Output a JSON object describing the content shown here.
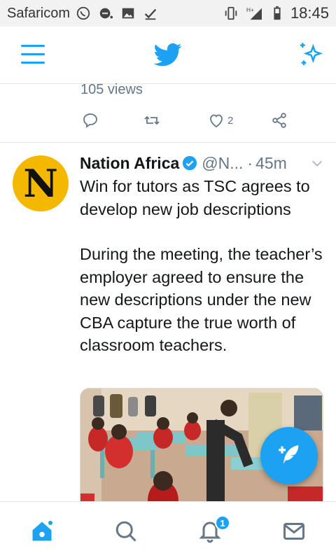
{
  "status_bar": {
    "carrier": "Safaricom",
    "network": "H+",
    "time": "18:45",
    "icons": [
      "whatsapp-icon",
      "chat-icon",
      "image-icon",
      "check-icon",
      "vibrate-icon",
      "signal-icon",
      "battery-icon"
    ]
  },
  "header": {
    "menu_icon": "hamburger-icon",
    "logo": "twitter-bird-icon",
    "sparkle_icon": "sparkle-icon"
  },
  "previous_tweet": {
    "views": "105 views",
    "like_count": "2"
  },
  "tweet": {
    "avatar_letter": "N",
    "author_name": "Nation Africa",
    "handle": "@N...",
    "separator": "·",
    "age": "45m",
    "headline": "Win for tutors as TSC agrees to develop new job descriptions",
    "body": "During the meeting, the teacher’s employer agreed to ensure the new descriptions under the new CBA capture the true worth of classroom teachers."
  },
  "notifications": {
    "badge_count": "1"
  },
  "colors": {
    "accent": "#1da1f2",
    "avatar_bg": "#f5b800",
    "muted_text": "#657786",
    "divider": "#e1e8ed"
  }
}
